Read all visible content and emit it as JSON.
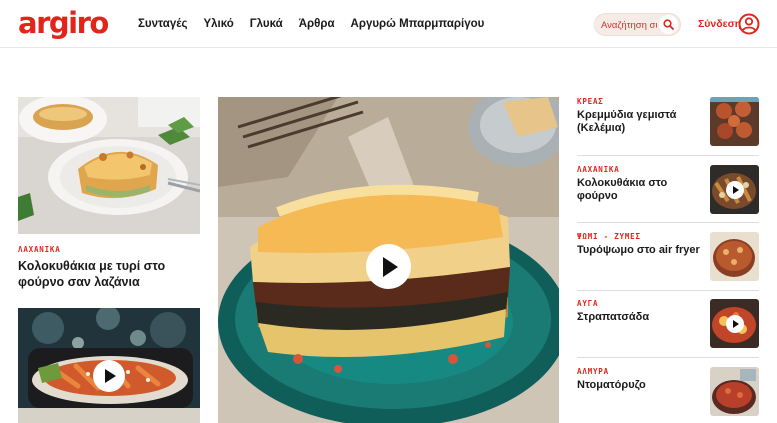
{
  "header": {
    "logo": "argiro",
    "nav": [
      "Συνταγές",
      "Υλικό",
      "Γλυκά",
      "Άρθρα",
      "Αργυρώ Μπαρμπαρίγου"
    ],
    "search_placeholder": "Αναζήτηση συνταγής",
    "login_label": "Σύνδεση"
  },
  "left_cards": [
    {
      "category": "ΛΑΧΑΝΙΚΑ",
      "title": "Κολοκυθάκια με τυρί στο φούρνο σαν λαζάνια",
      "has_video": false
    },
    {
      "category": "",
      "title": "",
      "has_video": true
    }
  ],
  "feature": {
    "has_video": true
  },
  "side_items": [
    {
      "category": "ΚΡΕΑΣ",
      "title": "Κρεμμύδια γεμιστά (Κελέμια)",
      "has_video": false
    },
    {
      "category": "ΛΑΧΑΝΙΚΑ",
      "title": "Κολοκυθάκια στο φούρνο",
      "has_video": true
    },
    {
      "category": "ΨΩΜΙ - ΖΥΜΕΣ",
      "title": "Τυρόψωμο στο air fryer",
      "has_video": false
    },
    {
      "category": "ΑΥΓΑ",
      "title": "Στραπατσάδα",
      "has_video": true
    },
    {
      "category": "ΑΛΜΥΡΑ",
      "title": "Ντοματόρυζο",
      "has_video": false
    }
  ],
  "colors": {
    "brand_red": "#e1251b",
    "text": "#1a1a1a",
    "divider": "#dedede"
  }
}
